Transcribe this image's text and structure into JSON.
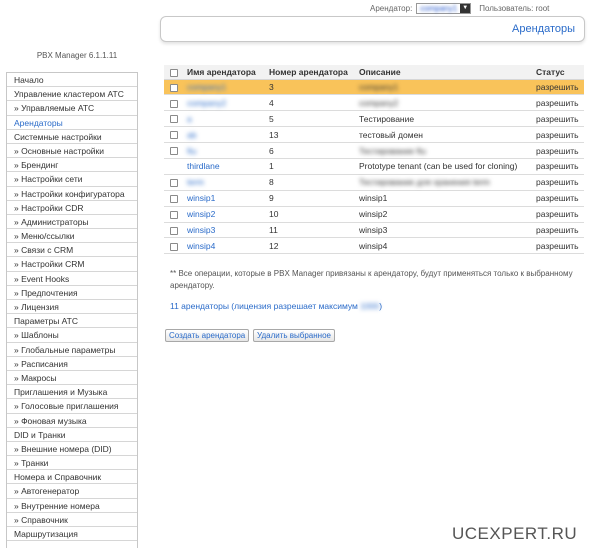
{
  "topbar": {
    "tenant_label": "Арендатор:",
    "tenant_value": "company1",
    "user_label": "Пользователь: root"
  },
  "page_title": "Арендаторы",
  "app_version": "PBX Manager 6.1.1.11",
  "sidebar": {
    "items": [
      {
        "label": "Начало"
      },
      {
        "label": "Управление кластером АТС"
      },
      {
        "label": "» Управляемые АТС"
      },
      {
        "label": "Арендаторы",
        "active": true
      },
      {
        "label": "Системные настройки"
      },
      {
        "label": "» Основные настройки"
      },
      {
        "label": "» Брендинг"
      },
      {
        "label": "» Настройки сети"
      },
      {
        "label": "» Настройки конфигуратора"
      },
      {
        "label": "» Настройки CDR"
      },
      {
        "label": "» Администраторы"
      },
      {
        "label": "» Меню/ссылки"
      },
      {
        "label": "» Связи с CRM"
      },
      {
        "label": "» Настройки CRM"
      },
      {
        "label": "» Event Hooks"
      },
      {
        "label": "» Предпочтения"
      },
      {
        "label": "» Лицензия"
      },
      {
        "label": "Параметры АТС"
      },
      {
        "label": "» Шаблоны"
      },
      {
        "label": "» Глобальные параметры"
      },
      {
        "label": "» Расписания"
      },
      {
        "label": "» Макросы"
      },
      {
        "label": "Приглашения и Музыка"
      },
      {
        "label": "» Голосовые приглашения"
      },
      {
        "label": "» Фоновая музыка"
      },
      {
        "label": "DID и Транки"
      },
      {
        "label": "» Внешние номера (DID)"
      },
      {
        "label": "» Транки"
      },
      {
        "label": "Номера и Справочник"
      },
      {
        "label": "» Автогенератор"
      },
      {
        "label": "» Внутренние номера"
      },
      {
        "label": "» Справочник"
      },
      {
        "label": "Маршрутизация"
      }
    ]
  },
  "table": {
    "headers": [
      "Имя арендатора",
      "Номер арендатора",
      "Описание",
      "Статус"
    ],
    "rows": [
      {
        "name": "company1",
        "number": "3",
        "desc": "company1",
        "status": "разрешить",
        "selected": true,
        "blur_name": true,
        "blur_desc": true,
        "has_checkbox": true
      },
      {
        "name": "company2",
        "number": "4",
        "desc": "company2",
        "status": "разрешить",
        "blur_name": true,
        "blur_desc": true,
        "has_checkbox": true
      },
      {
        "name": "a",
        "number": "5",
        "desc": "Тестирование",
        "status": "разрешить",
        "blur_name": true,
        "has_checkbox": true
      },
      {
        "name": "ab",
        "number": "13",
        "desc": "тестовый домен",
        "status": "разрешить",
        "blur_name": true,
        "has_checkbox": true
      },
      {
        "name": "ftu",
        "number": "6",
        "desc": "Тестирование ftu",
        "status": "разрешить",
        "blur_name": true,
        "blur_desc": true,
        "has_checkbox": true
      },
      {
        "name": "thirdlane",
        "number": "1",
        "desc": "Prototype tenant (can be used for cloning)",
        "status": "разрешить",
        "has_checkbox": false
      },
      {
        "name": "term",
        "number": "8",
        "desc": "Тестирование для хранения term",
        "status": "разрешить",
        "blur_name": true,
        "blur_desc": true,
        "has_checkbox": true
      },
      {
        "name": "winsip1",
        "number": "9",
        "desc": "winsip1",
        "status": "разрешить",
        "has_checkbox": true
      },
      {
        "name": "winsip2",
        "number": "10",
        "desc": "winsip2",
        "status": "разрешить",
        "has_checkbox": true
      },
      {
        "name": "winsip3",
        "number": "11",
        "desc": "winsip3",
        "status": "разрешить",
        "has_checkbox": true
      },
      {
        "name": "winsip4",
        "number": "12",
        "desc": "winsip4",
        "status": "разрешить",
        "has_checkbox": true
      }
    ]
  },
  "note": "** Все операции, которые в PBX Manager привязаны к арендатору, будут применяться только к выбранному арендатору.",
  "license": {
    "prefix": "11 арендаторы (лицензия разрешает максимум ",
    "max": "1000",
    "suffix": ")"
  },
  "buttons": {
    "create": "Создать арендатора",
    "delete": "Удалить выбранное"
  },
  "watermark": "UCEXPERT.RU",
  "colors": {
    "accent": "#2a6bc9",
    "selected_row": "#f9c35a"
  }
}
